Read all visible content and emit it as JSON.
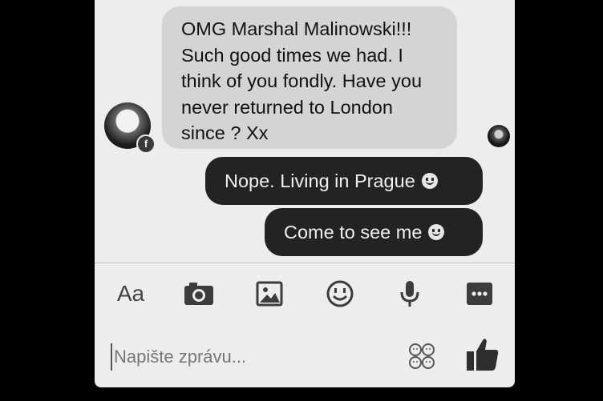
{
  "messages": {
    "incoming": {
      "text": "OMG Marshal Malinowski!!! Such good times we had. I think of you fondly. Have you never returned to London since ? Xx",
      "avatar_icon": "user-avatar",
      "badge_icon": "facebook-icon"
    },
    "outgoing": [
      {
        "text": "Nope. Living in Prague"
      },
      {
        "text": "Come to see me"
      }
    ],
    "seen_avatar_icon": "user-avatar"
  },
  "toolbar": {
    "text_label": "Aa",
    "icons": [
      "camera-icon",
      "image-icon",
      "emoji-icon",
      "microphone-icon",
      "more-icon"
    ]
  },
  "composer": {
    "placeholder": "Napište zprávu...",
    "sticker_icon": "sticker-icon",
    "like_icon": "thumbs-up-icon"
  },
  "colors": {
    "incoming_bubble": "#d4d4d4",
    "outgoing_bubble": "#232323",
    "background": "#ededed"
  }
}
